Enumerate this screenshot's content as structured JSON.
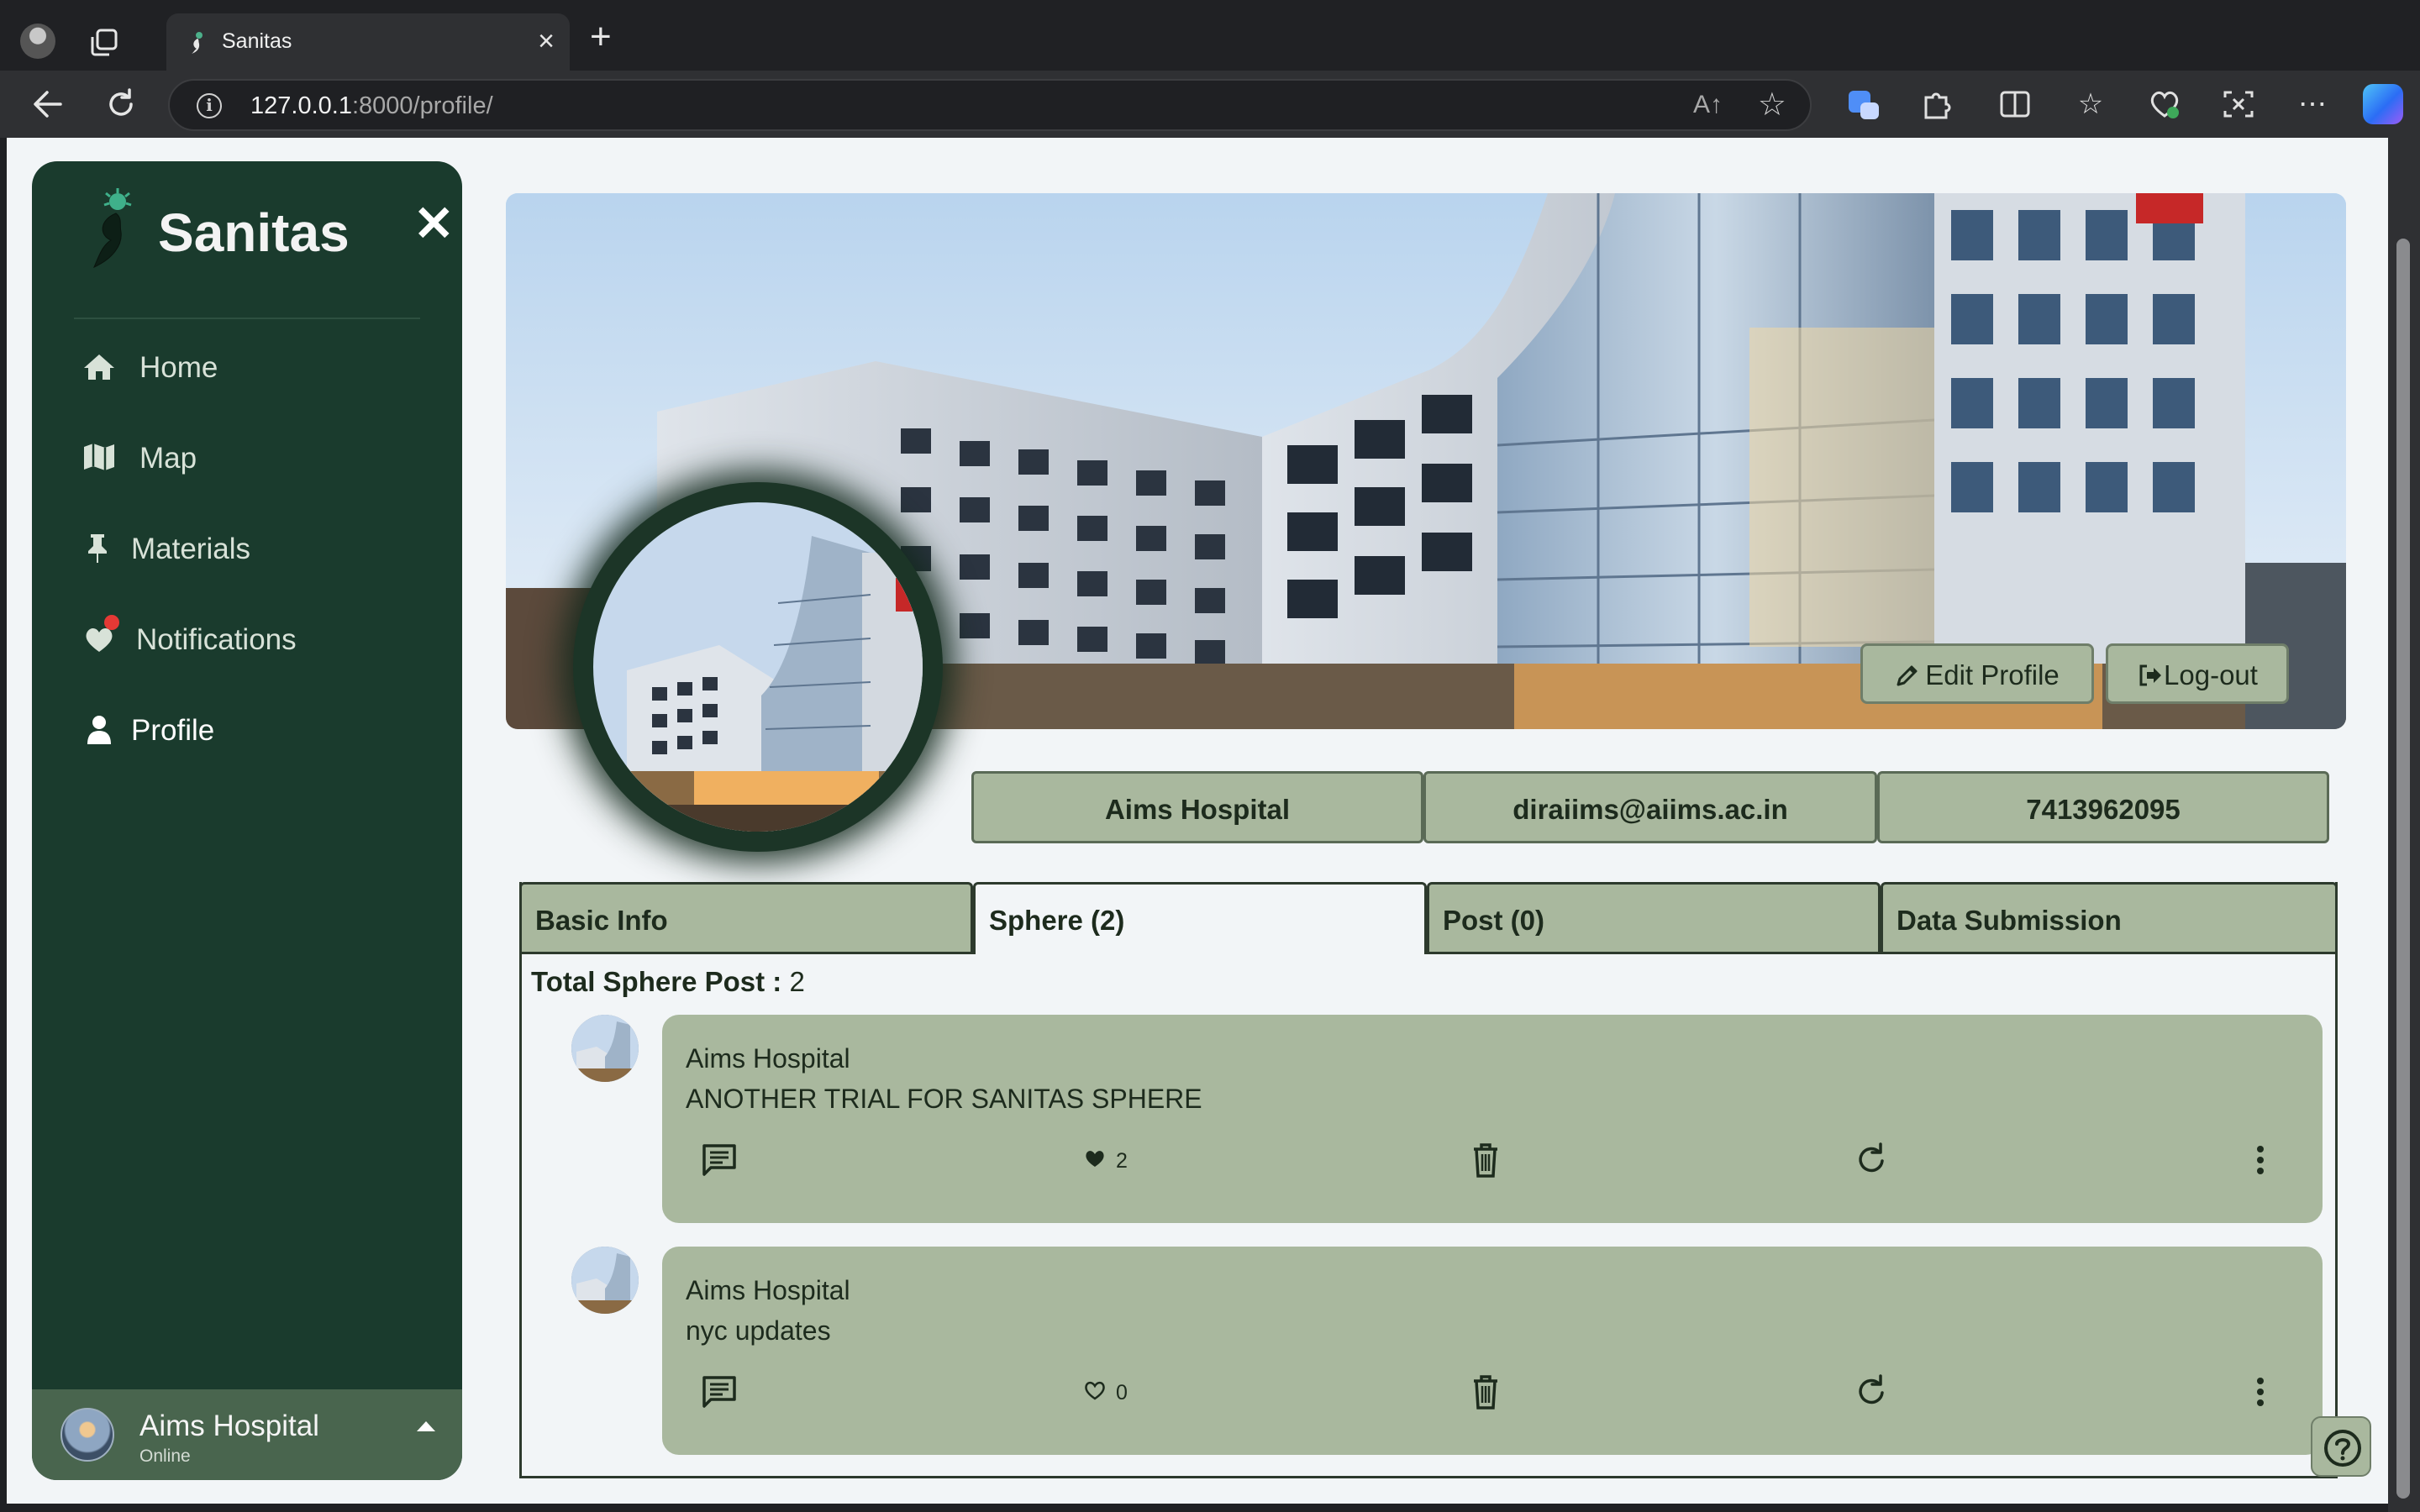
{
  "browser": {
    "tab_title": "Sanitas",
    "url_host": "127.0.0.1",
    "url_rest": ":8000/profile/",
    "read_aloud": "A↑"
  },
  "sidebar": {
    "brand": "Sanitas",
    "close_glyph": "✕",
    "items": [
      {
        "label": "Home",
        "icon": "home-icon"
      },
      {
        "label": "Map",
        "icon": "map-icon"
      },
      {
        "label": "Materials",
        "icon": "pin-icon"
      },
      {
        "label": "Notifications",
        "icon": "heart-icon"
      },
      {
        "label": "Profile",
        "icon": "user-icon"
      }
    ],
    "user": {
      "name": "Aims Hospital",
      "status": "Online"
    }
  },
  "profile": {
    "edit_label": "Edit Profile",
    "logout_label": "Log-out",
    "name": "Aims Hospital",
    "email": "diraiims@aiims.ac.in",
    "phone": "7413962095"
  },
  "tabs": [
    {
      "label": "Basic Info"
    },
    {
      "label": "Sphere (2)"
    },
    {
      "label": "Post (0)"
    },
    {
      "label": "Data Submission"
    }
  ],
  "sphere": {
    "total_label": "Total Sphere Post :",
    "total_value": "2",
    "posts": [
      {
        "author": "Aims Hospital",
        "text": "ANOTHER TRIAL FOR SANITAS SPHERE",
        "likes": "2",
        "liked": true
      },
      {
        "author": "Aims Hospital",
        "text": "nyc updates",
        "likes": "0",
        "liked": false
      }
    ]
  },
  "colors": {
    "sidebar_bg": "#1a3b2d",
    "card_bg": "#a9b89e",
    "page_bg": "#f2f5f7",
    "accent_dark": "#1d2b1d"
  }
}
